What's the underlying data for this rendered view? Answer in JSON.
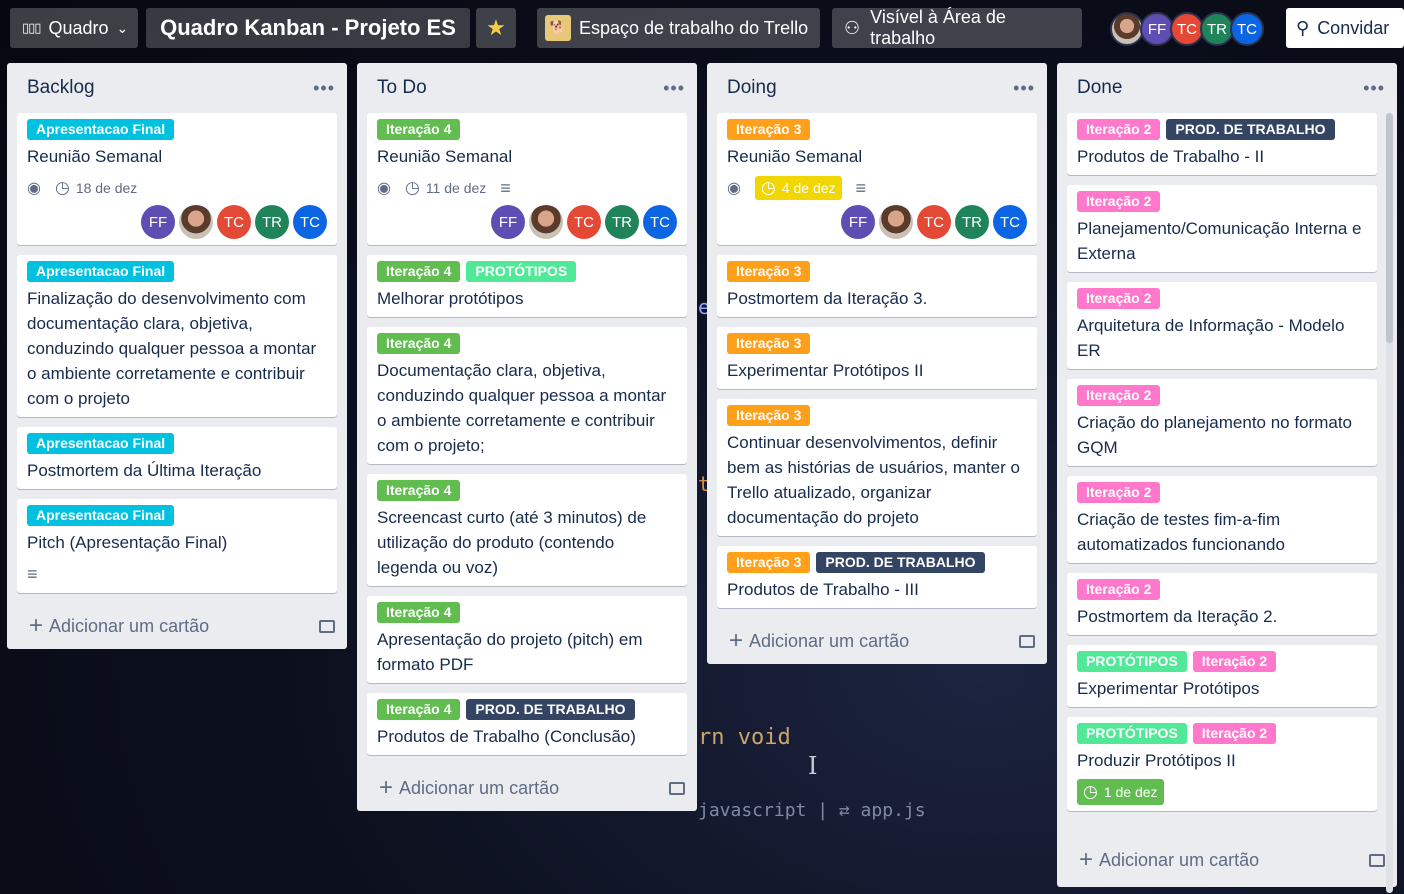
{
  "topbar": {
    "board_switch": "Quadro",
    "board_title": "Quadro Kanban - Projeto ES",
    "workspace": "Espaço de trabalho do Trello",
    "visibility": "Visível à Área de trabalho",
    "invite": "Convidar",
    "members": [
      {
        "initials": "",
        "color": "#8a6a58",
        "photo": true
      },
      {
        "initials": "FF",
        "color": "#5e4db2"
      },
      {
        "initials": "TC",
        "color": "#e34935"
      },
      {
        "initials": "TR",
        "color": "#1f845a"
      },
      {
        "initials": "TC",
        "color": "#0c66e4"
      }
    ]
  },
  "colors": {
    "label_final": "#00c2e0",
    "label_iter4": "#61bd4f",
    "label_iter3": "#ff9f1a",
    "label_iter2": "#ff78cb",
    "label_prod": "#344563",
    "label_proto": "#51e898"
  },
  "lists": [
    {
      "title": "Backlog",
      "add_label": "Adicionar um cartão",
      "cards": [
        {
          "labels": [
            "Apresentacao Final"
          ],
          "title": "Reunião Semanal",
          "due": "18 de dez"
        },
        {
          "labels": [
            "Apresentacao Final"
          ],
          "title": "Finalização do desenvolvimento com documentação clara, objetiva, conduzindo qualquer pessoa a montar o ambiente corretamente e contribuir com o projeto"
        },
        {
          "labels": [
            "Apresentacao Final"
          ],
          "title": "Postmortem da Última Iteração"
        },
        {
          "labels": [
            "Apresentacao Final"
          ],
          "title": "Pitch (Apresentação Final)"
        }
      ]
    },
    {
      "title": "To Do",
      "add_label": "Adicionar um cartão",
      "cards": [
        {
          "labels": [
            "Iteração 4"
          ],
          "title": "Reunião Semanal",
          "due": "11 de dez"
        },
        {
          "labels": [
            "Iteração 4",
            "PROTÓTIPOS"
          ],
          "title": "Melhorar protótipos"
        },
        {
          "labels": [
            "Iteração 4"
          ],
          "title": "Documentação clara, objetiva, conduzindo qualquer pessoa a montar o ambiente corretamente e contribuir com o projeto;"
        },
        {
          "labels": [
            "Iteração 4"
          ],
          "title": "Screencast curto (até 3 minutos) de utilização do produto (contendo legenda ou voz)"
        },
        {
          "labels": [
            "Iteração 4"
          ],
          "title": "Apresentação do projeto (pitch) em formato PDF"
        },
        {
          "labels": [
            "Iteração 4",
            "PROD. DE TRABALHO"
          ],
          "title": "Produtos de Trabalho (Conclusão)"
        }
      ]
    },
    {
      "title": "Doing",
      "add_label": "Adicionar um cartão",
      "cards": [
        {
          "labels": [
            "Iteração 3"
          ],
          "title": "Reunião Semanal",
          "due": "4 de dez"
        },
        {
          "labels": [
            "Iteração 3"
          ],
          "title": "Postmortem da Iteração 3."
        },
        {
          "labels": [
            "Iteração 3"
          ],
          "title": "Experimentar Protótipos II"
        },
        {
          "labels": [
            "Iteração 3"
          ],
          "title": "Continuar desenvolvimentos, definir bem as histórias de usuários, manter o Trello atualizado, organizar documentação do projeto"
        },
        {
          "labels": [
            "Iteração 3",
            "PROD. DE TRABALHO"
          ],
          "title": "Produtos de Trabalho - III"
        }
      ]
    },
    {
      "title": "Done",
      "add_label": "Adicionar um cartão",
      "cards": [
        {
          "labels": [
            "Iteração 2",
            "PROD. DE TRABALHO"
          ],
          "title": "Produtos de Trabalho - II"
        },
        {
          "labels": [
            "Iteração 2"
          ],
          "title": "Planejamento/Comunicação Interna e Externa"
        },
        {
          "labels": [
            "Iteração 2"
          ],
          "title": "Arquitetura de Informação - Modelo ER"
        },
        {
          "labels": [
            "Iteração 2"
          ],
          "title": "Criação do planejamento no formato GQM"
        },
        {
          "labels": [
            "Iteração 2"
          ],
          "title": "Criação de testes fim-a-fim automatizados funcionando"
        },
        {
          "labels": [
            "Iteração 2"
          ],
          "title": "Postmortem da Iteração 2."
        },
        {
          "labels": [
            "PROTÓTIPOS",
            "Iteração 2"
          ],
          "title": "Experimentar Protótipos"
        },
        {
          "labels": [
            "PROTÓTIPOS",
            "Iteração 2"
          ],
          "title": "Produzir Protótipos II",
          "due": "1 de dez"
        }
      ]
    }
  ],
  "card_members": [
    {
      "initials": "FF",
      "color": "#5e4db2"
    },
    {
      "initials": "",
      "color": "#8a6a58",
      "photo": true
    },
    {
      "initials": "TC",
      "color": "#e34935"
    },
    {
      "initials": "TR",
      "color": "#1f845a"
    },
    {
      "initials": "TC",
      "color": "#0c66e4"
    }
  ],
  "background": {
    "code1": "rn void",
    "code2": "javascript | ⇄ app.js",
    "edge1": "e",
    "edge2": "t"
  }
}
